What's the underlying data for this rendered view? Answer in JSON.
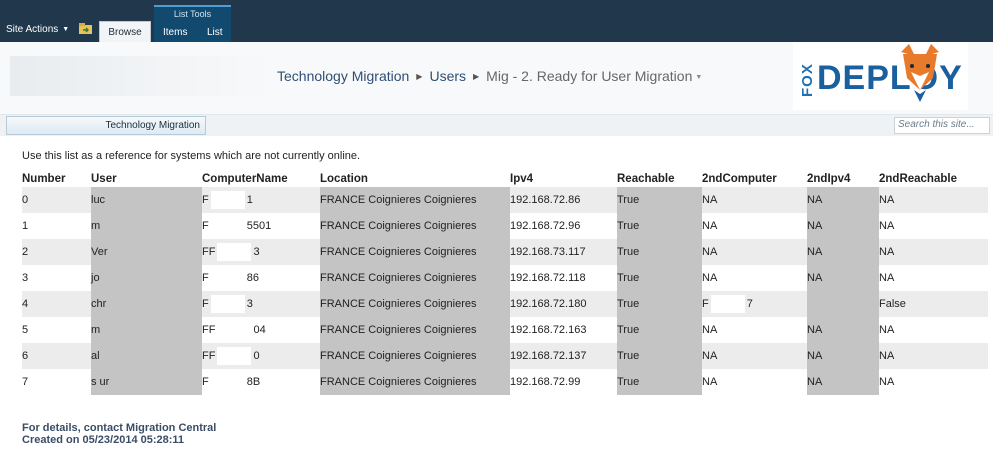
{
  "ribbon": {
    "site_actions_label": "Site Actions",
    "browse_tab": "Browse",
    "list_tools_label": "List Tools",
    "items_tab": "Items",
    "list_tab": "List",
    "background_color": "#21374c"
  },
  "breadcrumb": {
    "items": [
      "Technology Migration",
      "Users",
      "Mig - 2. Ready for User Migration"
    ]
  },
  "logo": {
    "vertical_text": "FOX",
    "main_text": "DEPLOY",
    "accent_color": "#e87a2b"
  },
  "quicknav": {
    "tab_label": "Technology Migration",
    "search_placeholder": "Search this site..."
  },
  "description": "Use this list as a reference for systems which are not currently online.",
  "table": {
    "headers": [
      "Number",
      "User",
      "ComputerName",
      "Location",
      "Ipv4",
      "Reachable",
      "2ndComputer",
      "2ndIpv4",
      "2ndReachable"
    ],
    "rows": [
      {
        "number": "0",
        "user": "luc",
        "computer": [
          "F",
          "1"
        ],
        "location": "FRANCE Coignieres Coignieres",
        "ipv4": "192.168.72.86",
        "reachable": "True",
        "second_computer": "NA",
        "second_ipv4": "NA",
        "second_reachable": "NA"
      },
      {
        "number": "1",
        "user": "m",
        "computer": [
          "F",
          "5501"
        ],
        "location": "FRANCE Coignieres Coignieres",
        "ipv4": "192.168.72.96",
        "reachable": "True",
        "second_computer": "NA",
        "second_ipv4": "NA",
        "second_reachable": "NA"
      },
      {
        "number": "2",
        "user": "Ver",
        "computer": [
          "FF",
          "3"
        ],
        "location": "FRANCE Coignieres Coignieres",
        "ipv4": "192.168.73.117",
        "reachable": "True",
        "second_computer": "NA",
        "second_ipv4": "NA",
        "second_reachable": "NA"
      },
      {
        "number": "3",
        "user": "jo",
        "computer": [
          "F",
          "86"
        ],
        "location": "FRANCE Coignieres Coignieres",
        "ipv4": "192.168.72.118",
        "reachable": "True",
        "second_computer": "NA",
        "second_ipv4": "NA",
        "second_reachable": "NA"
      },
      {
        "number": "4",
        "user": "chr",
        "computer": [
          "F",
          "3"
        ],
        "location": "FRANCE Coignieres Coignieres",
        "ipv4": "192.168.72.180",
        "reachable": "True",
        "second_computer": "F 7",
        "second_ipv4": "",
        "second_reachable": "False"
      },
      {
        "number": "5",
        "user": "m",
        "computer": [
          "FF",
          "04"
        ],
        "location": "FRANCE Coignieres Coignieres",
        "ipv4": "192.168.72.163",
        "reachable": "True",
        "second_computer": "NA",
        "second_ipv4": "NA",
        "second_reachable": "NA"
      },
      {
        "number": "6",
        "user": "al",
        "computer": [
          "FF",
          "0"
        ],
        "location": "FRANCE Coignieres Coignieres",
        "ipv4": "192.168.72.137",
        "reachable": "True",
        "second_computer": "NA",
        "second_ipv4": "NA",
        "second_reachable": "NA"
      },
      {
        "number": "7",
        "user": "s ur",
        "computer": [
          "F",
          "8B"
        ],
        "location": "FRANCE Coignieres Coignieres",
        "ipv4": "192.168.72.99",
        "reachable": "True",
        "second_computer": "NA",
        "second_ipv4": "NA",
        "second_reachable": "NA"
      }
    ]
  },
  "footer": {
    "line1": "For details, contact Migration Central",
    "line2": "Created on 05/23/2014 05:28:11"
  }
}
